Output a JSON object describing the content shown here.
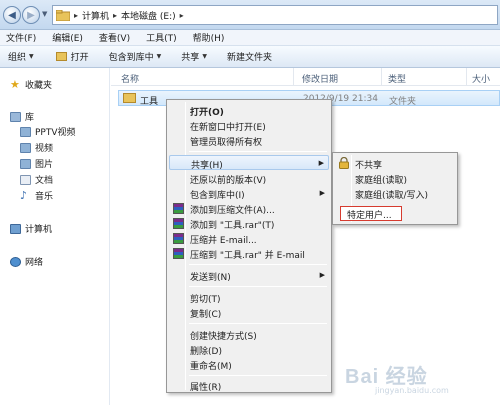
{
  "address": {
    "crumbs": [
      "计算机",
      "本地磁盘 (E:)"
    ],
    "separator": "▸"
  },
  "menubar": [
    "文件(F)",
    "编辑(E)",
    "查看(V)",
    "工具(T)",
    "帮助(H)"
  ],
  "toolbar": {
    "organize": "组织",
    "open": "打开",
    "include_in_library": "包含到库中",
    "share": "共享",
    "new_folder": "新建文件夹"
  },
  "navpane": {
    "favorites": "收藏夹",
    "libraries": "库",
    "pptv": "PPTV视频",
    "videos": "视频",
    "pictures": "图片",
    "documents": "文档",
    "music": "音乐",
    "computer": "计算机",
    "network": "网络"
  },
  "columns": {
    "name": "名称",
    "modified": "修改日期",
    "type": "类型",
    "size": "大小"
  },
  "file": {
    "name": "工具",
    "modified": "2012/9/19 21:34",
    "type": "文件夹"
  },
  "context_menu": {
    "open": "打开(O)",
    "open_new_window": "在新窗口中打开(E)",
    "take_ownership": "管理员取得所有权",
    "share": "共享(H)",
    "restore_previous": "还原以前的版本(V)",
    "include_in_library": "包含到库中(I)",
    "add_to_archive": "添加到压缩文件(A)...",
    "add_to_rar": "添加到 \"工具.rar\"(T)",
    "compress_email": "压缩并 E-mail...",
    "compress_rar_email": "压缩到 \"工具.rar\" 并 E-mail",
    "send_to": "发送到(N)",
    "cut": "剪切(T)",
    "copy": "复制(C)",
    "create_shortcut": "创建快捷方式(S)",
    "delete": "删除(D)",
    "rename": "重命名(M)",
    "properties": "属性(R)"
  },
  "share_submenu": {
    "nobody": "不共享",
    "homegroup_read": "家庭组(读取)",
    "homegroup_readwrite": "家庭组(读取/写入)",
    "specific_people": "特定用户..."
  },
  "watermark": {
    "brand": "Bai 经验",
    "url": "jingyan.baidu.com"
  },
  "colors": {
    "highlight_border": "#d63b2f",
    "selection": "#d3e8fb"
  }
}
